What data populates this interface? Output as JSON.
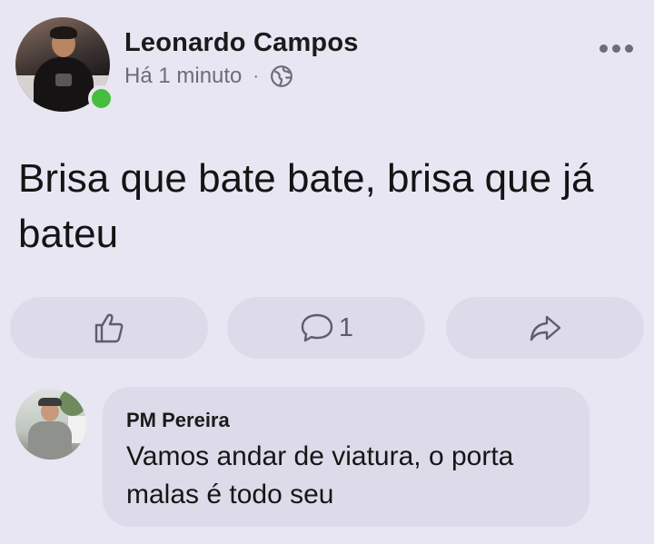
{
  "post": {
    "author": "Leonardo Campos",
    "time": "Há 1 minuto",
    "separator": "·",
    "audience_icon": "globe-icon",
    "online": true,
    "text": "Brisa que bate bate, brisa que já bateu"
  },
  "actions": {
    "like_icon": "thumbs-up-icon",
    "comment_icon": "comment-icon",
    "comment_count": "1",
    "share_icon": "share-icon"
  },
  "comment": {
    "author": "PM Pereira",
    "text": "Vamos andar de viatura, o porta malas é todo seu"
  },
  "colors": {
    "background": "#e8e6f2",
    "button": "#dddbe9",
    "online": "#45bd3e",
    "muted": "#6e6c78"
  }
}
